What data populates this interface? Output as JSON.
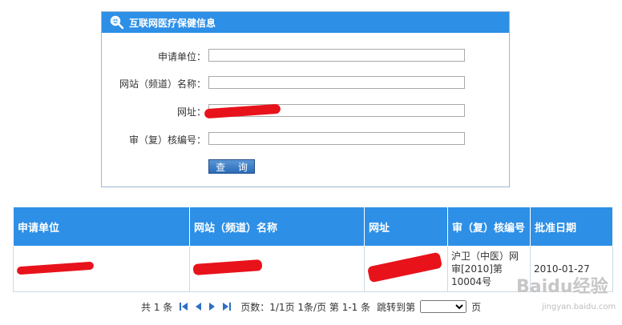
{
  "panel": {
    "title": "互联网医疗保健信息",
    "fields": [
      {
        "label": "申请单位：",
        "value": ""
      },
      {
        "label": "网站（频道）名称：",
        "value": ""
      },
      {
        "label": "网址：",
        "value": ""
      },
      {
        "label": "审（复）核编号：",
        "value": ""
      }
    ],
    "query_button": "查 询"
  },
  "table": {
    "headers": [
      "申请单位",
      "网站（频道）名称",
      "网址",
      "审（复）核编号",
      "批准日期"
    ],
    "rows": [
      {
        "unit": "",
        "site_name": "",
        "url": "",
        "review_number": "沪卫（中医）网审[2010]第10004号",
        "approval_date": "2010-01-27"
      }
    ]
  },
  "pager": {
    "total": "共 1 条",
    "page_info": "页数：1/1页 1条/页 第 1-1 条",
    "jump_label": "跳转到第",
    "jump_select_value": "",
    "page_suffix": "页"
  },
  "watermark": {
    "logo_text": "Baidu经验",
    "sub_text": "jingyan.baidu.com"
  },
  "colors": {
    "header_blue": "#2d8fe6",
    "redaction_red": "#e8121b"
  }
}
